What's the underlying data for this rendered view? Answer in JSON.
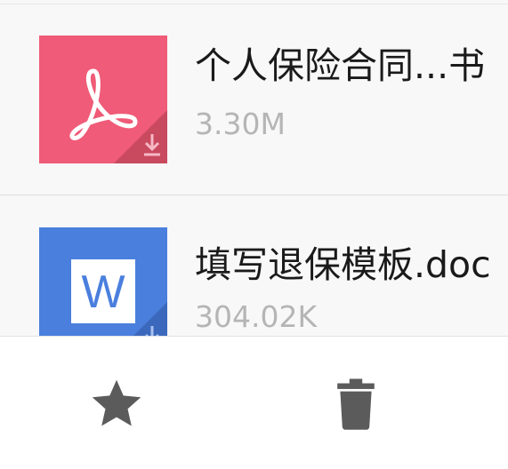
{
  "files": [
    {
      "name": "个人保险合同...书",
      "size": "3.30M",
      "icon": "pdf-icon",
      "color": "#ef5b78"
    },
    {
      "name": "填写退保模板.doc",
      "size": "304.02K",
      "icon": "word-icon",
      "color": "#4a7fdd",
      "icon_letter": "W"
    }
  ],
  "toolbar": {
    "actions": [
      {
        "icon": "star-icon"
      },
      {
        "icon": "trash-icon"
      }
    ],
    "icon_color": "#5b5b5b"
  }
}
